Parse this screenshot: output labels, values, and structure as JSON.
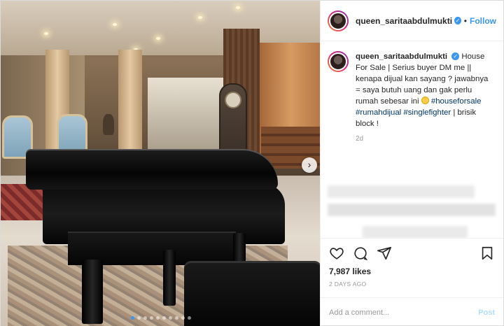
{
  "header": {
    "username": "queen_saritaabdulmukti",
    "separator": "•",
    "follow_label": "Follow"
  },
  "caption": {
    "username": "queen_saritaabdulmukti",
    "text_1": "House For Sale | Serius buyer DM me || kenapa dijual kan sayang ? jawabnya = saya butuh uang dan gak perlu rumah sebesar ini",
    "hashtag_1": "#houseforsale",
    "hashtag_2": "#rumahdijual",
    "hashtag_3": "#singlefighter",
    "text_2": "| brisik block !",
    "age": "2d"
  },
  "photo": {
    "next_arrow": "›",
    "carousel_count": 10,
    "carousel_active": 1
  },
  "actions": {
    "icons": [
      "heart-icon",
      "comment-icon",
      "share-icon",
      "bookmark-icon"
    ],
    "likes": "7,987 likes",
    "date": "2 DAYS AGO"
  },
  "comment_box": {
    "placeholder": "Add a comment...",
    "post_label": "Post"
  },
  "colors": {
    "accent": "#3897f0",
    "hashtag": "#003569",
    "muted": "#999999",
    "post_disabled": "#b2dffc"
  }
}
